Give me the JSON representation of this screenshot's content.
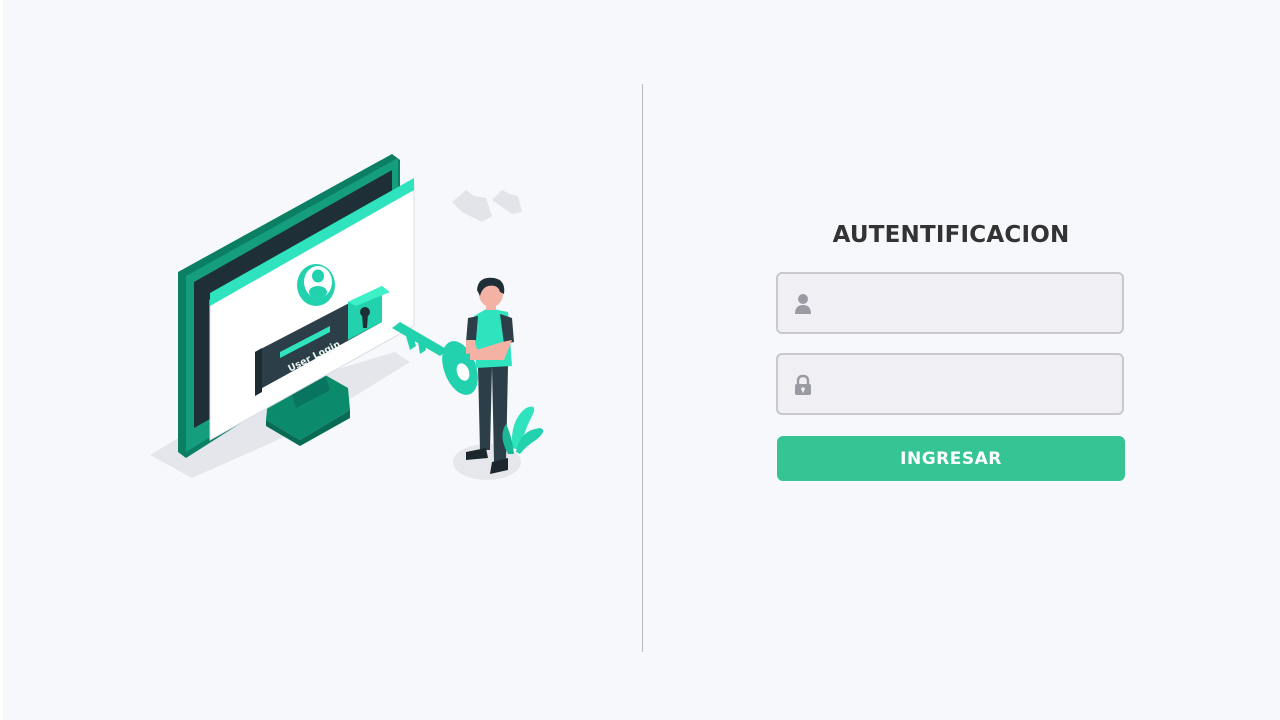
{
  "login": {
    "title": "AUTENTIFICACION",
    "username_placeholder": "",
    "password_placeholder": "",
    "submit_label": "INGRESAR"
  },
  "illustration": {
    "screen_caption": "User Login"
  },
  "colors": {
    "accent": "#35c493",
    "teal": "#0f9e7e",
    "mint": "#21d6b0",
    "background": "#f7f8fc",
    "title_text": "#333333",
    "field_background": "#f0f0f4",
    "field_border": "#c8c8cd",
    "icon_grey": "#9a9aa2"
  },
  "icons": {
    "username": "user-icon",
    "password": "lock-icon"
  }
}
